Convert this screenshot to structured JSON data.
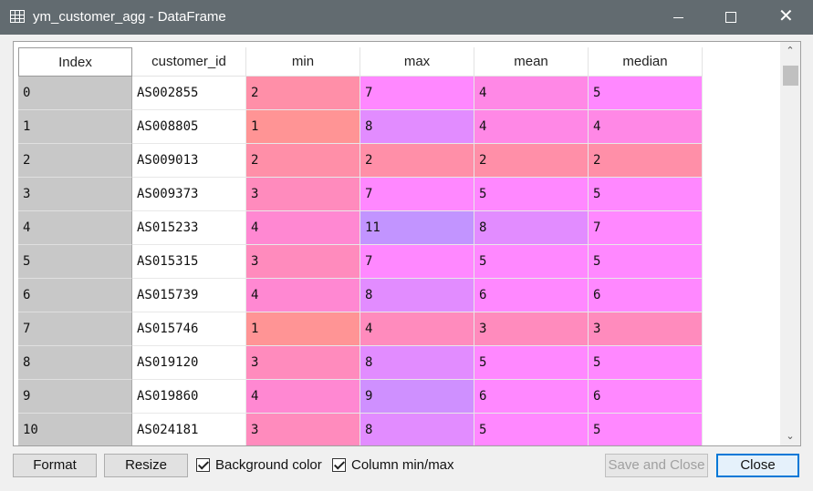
{
  "window": {
    "title": "ym_customer_agg - DataFrame",
    "minimize_icon": "minimize-icon",
    "maximize_icon": "maximize-icon",
    "close_glyph": "✕"
  },
  "table": {
    "columns": [
      "Index",
      "customer_id",
      "min",
      "max",
      "mean",
      "median"
    ],
    "rows": [
      {
        "index": "0",
        "customer_id": "AS002855",
        "min": "2",
        "max": "7",
        "mean": "4",
        "median": "5"
      },
      {
        "index": "1",
        "customer_id": "AS008805",
        "min": "1",
        "max": "8",
        "mean": "4",
        "median": "4"
      },
      {
        "index": "2",
        "customer_id": "AS009013",
        "min": "2",
        "max": "2",
        "mean": "2",
        "median": "2"
      },
      {
        "index": "3",
        "customer_id": "AS009373",
        "min": "3",
        "max": "7",
        "mean": "5",
        "median": "5"
      },
      {
        "index": "4",
        "customer_id": "AS015233",
        "min": "4",
        "max": "11",
        "mean": "8",
        "median": "7"
      },
      {
        "index": "5",
        "customer_id": "AS015315",
        "min": "3",
        "max": "7",
        "mean": "5",
        "median": "5"
      },
      {
        "index": "6",
        "customer_id": "AS015739",
        "min": "4",
        "max": "8",
        "mean": "6",
        "median": "6"
      },
      {
        "index": "7",
        "customer_id": "AS015746",
        "min": "1",
        "max": "4",
        "mean": "3",
        "median": "3"
      },
      {
        "index": "8",
        "customer_id": "AS019120",
        "min": "3",
        "max": "8",
        "mean": "5",
        "median": "5"
      },
      {
        "index": "9",
        "customer_id": "AS019860",
        "min": "4",
        "max": "9",
        "mean": "6",
        "median": "6"
      },
      {
        "index": "10",
        "customer_id": "AS024181",
        "min": "3",
        "max": "8",
        "mean": "5",
        "median": "5"
      }
    ],
    "cell_colors": {
      "min": [
        "#ff8fa8",
        "#ff9495",
        "#ff8fa8",
        "#ff8bbd",
        "#ff88d2",
        "#ff8bbd",
        "#ff88d2",
        "#ff9495",
        "#ff8bbd",
        "#ff88d2",
        "#ff8bbd"
      ],
      "max": [
        "#ff88ff",
        "#e28cff",
        "#ff8fa8",
        "#ff88ff",
        "#c294ff",
        "#ff88ff",
        "#e28cff",
        "#ff8bbd",
        "#e28cff",
        "#cf90ff",
        "#e28cff"
      ],
      "mean": [
        "#ff88e6",
        "#ff88e6",
        "#ff8fa8",
        "#ff88ff",
        "#e28cff",
        "#ff88ff",
        "#ff88ff",
        "#ff8bbd",
        "#ff88ff",
        "#ff88ff",
        "#ff88ff"
      ],
      "median": [
        "#ff88ff",
        "#ff88e6",
        "#ff8fa8",
        "#ff88ff",
        "#ff88ff",
        "#ff88ff",
        "#ff88ff",
        "#ff8bbd",
        "#ff88ff",
        "#ff88ff",
        "#ff88ff"
      ]
    }
  },
  "buttons": {
    "format": "Format",
    "resize": "Resize",
    "save_and_close": "Save and Close",
    "close": "Close"
  },
  "checkboxes": {
    "background_color": {
      "label": "Background color",
      "checked": true
    },
    "column_minmax": {
      "label": "Column min/max",
      "checked": true
    }
  },
  "scrollbar": {
    "up": "⌃",
    "down": "⌄"
  }
}
